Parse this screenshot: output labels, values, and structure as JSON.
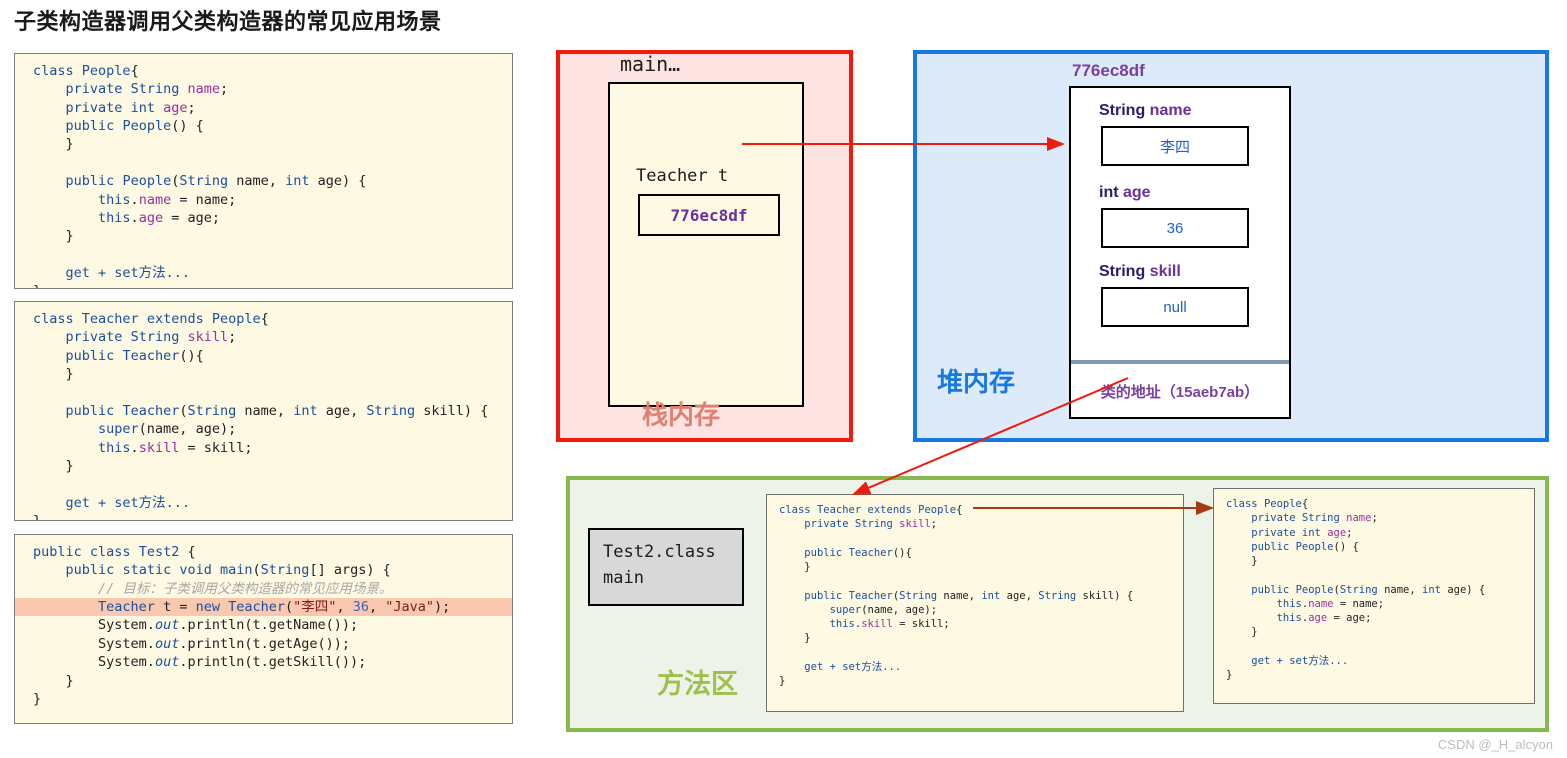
{
  "page": {
    "title": "子类构造器调用父类构造器的常见应用场景",
    "watermark": "CSDN @_H_alcyon"
  },
  "code_blocks": {
    "people": {
      "name": "People class source",
      "lines": [
        "class People{",
        "    private String name;",
        "    private int age;",
        "    public People() {",
        "    }",
        "",
        "    public People(String name, int age) {",
        "        this.name = name;",
        "        this.age = age;",
        "    }",
        "",
        "    get + set方法...",
        "}"
      ]
    },
    "teacher": {
      "name": "Teacher class source",
      "lines": [
        "class Teacher extends People{",
        "    private String skill;",
        "    public Teacher(){",
        "    }",
        "",
        "    public Teacher(String name, int age, String skill) {",
        "        super(name, age);",
        "        this.skill = skill;",
        "    }",
        "",
        "    get + set方法...",
        "}"
      ]
    },
    "test2": {
      "name": "Test2 main source",
      "lines": [
        "public class Test2 {",
        "    public static void main(String[] args) {",
        "        // 目标：子类调用父类构造器的常见应用场景。",
        "        Teacher t = new Teacher(\"李四\", 36, \"Java\");",
        "        System.out.println(t.getName());",
        "        System.out.println(t.getAge());",
        "        System.out.println(t.getSkill());",
        "    }",
        "}"
      ],
      "highlighted_line_index": 3
    }
  },
  "stack": {
    "label": "栈内存",
    "frame_title": "main…",
    "variable_label": "Teacher  t",
    "variable_value": "776ec8df",
    "border_color": "#f01b0c",
    "fill_color": "#fde3e1",
    "label_color": "#e08070"
  },
  "heap": {
    "label": "堆内存",
    "object_address": "776ec8df",
    "fields": [
      {
        "type": "String",
        "name": "name",
        "value": "李四"
      },
      {
        "type": "int",
        "name": "age",
        "value": "36"
      },
      {
        "type": "String",
        "name": "skill",
        "value": "null"
      }
    ],
    "class_address_label": "类的地址（15aeb7ab）",
    "border_color": "#1578e3",
    "fill_color": "#ddeaf9",
    "label_color": "#1578e3"
  },
  "method_area": {
    "label": "方法区",
    "class_file": {
      "file_name": "Test2.class",
      "member": "main"
    },
    "border_color": "#86b84d",
    "fill_color": "#eef3e9",
    "label_color": "#9dc04e"
  },
  "arrows": [
    {
      "name": "stack-to-heap",
      "color": "#f01b0c",
      "from": "Teacher t reference",
      "to": "heap object 776ec8df"
    },
    {
      "name": "heap-to-method-area",
      "color": "#f01b0c",
      "from": "类的地址（15aeb7ab）",
      "to": "Teacher class in method area"
    },
    {
      "name": "teacher-to-people-class",
      "color": "#a63a12",
      "from": "class Teacher extends People{",
      "to": "People class in method area"
    }
  ]
}
